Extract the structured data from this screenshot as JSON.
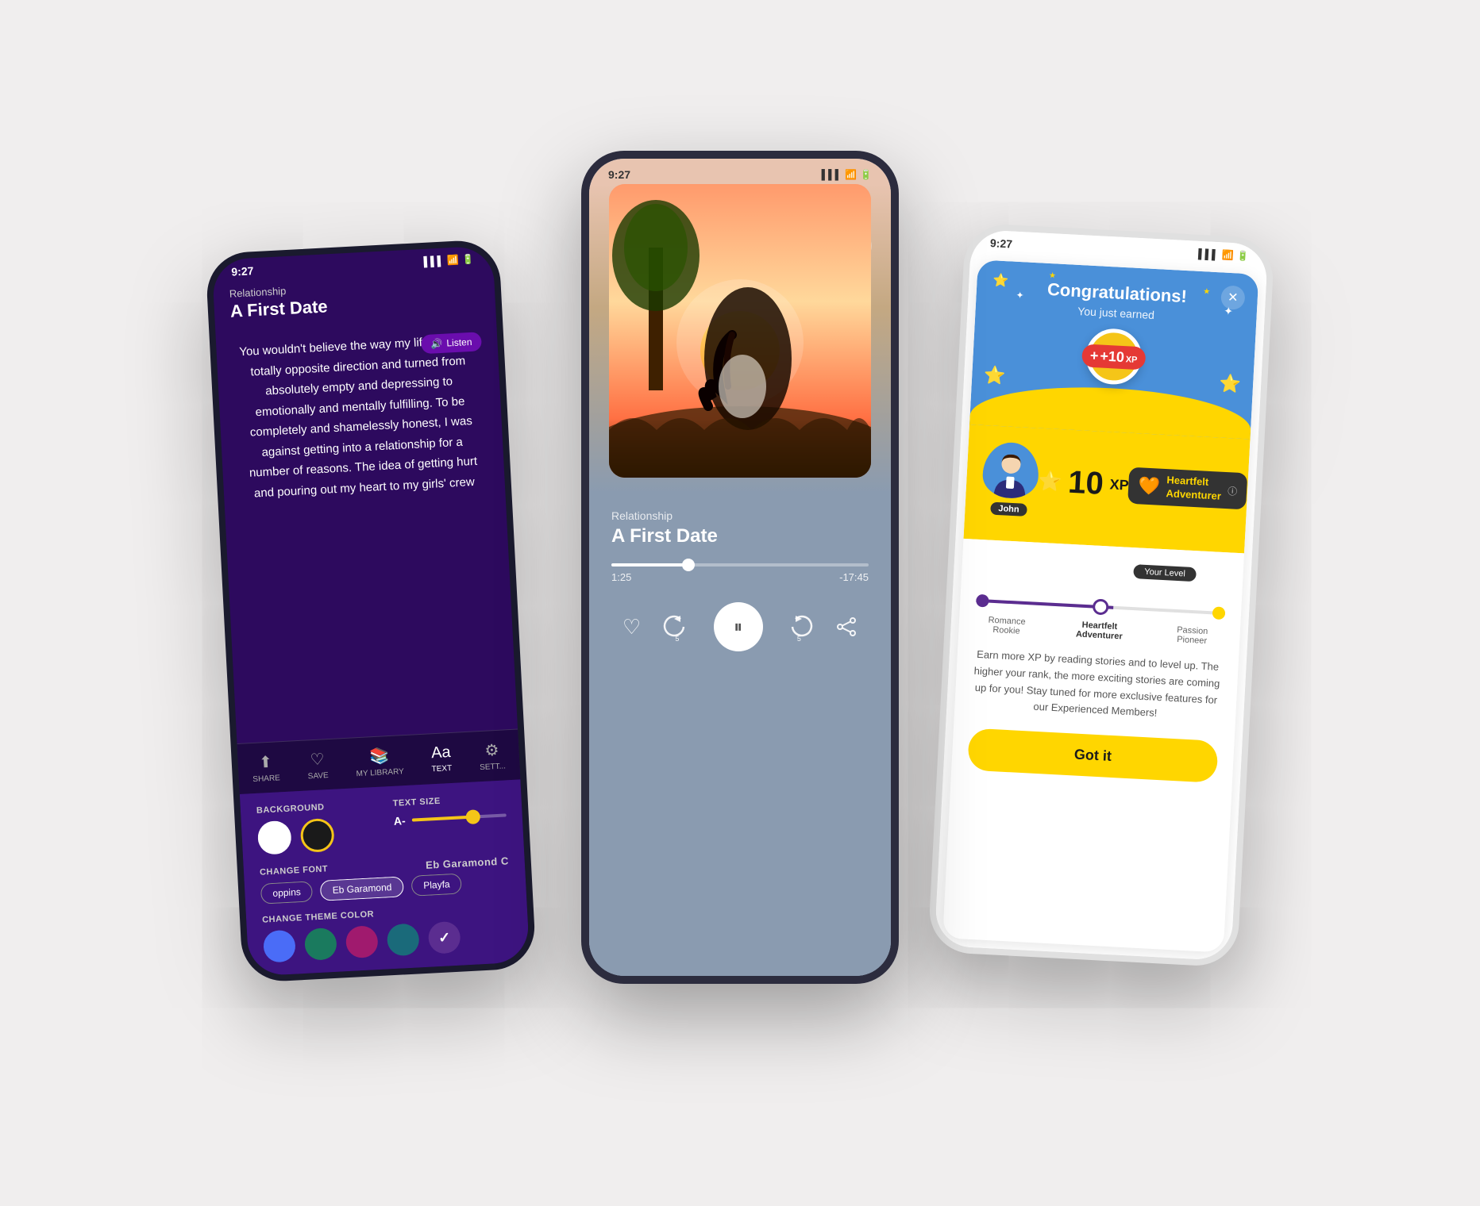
{
  "left_phone": {
    "status_bar": {
      "time": "9:27",
      "signal": "▌▌▌",
      "wifi": "WiFi",
      "battery": "Battery"
    },
    "header": {
      "category": "Relationship",
      "title": "A First Date",
      "listen_btn": "Listen"
    },
    "story_text": "You wouldn't believe the way my life took the totally opposite direction and turned from absolutely empty and depressing to emotionally and mentally fulfilling. To be completely and shamelessly honest, I was against getting into a relationship for a number of reasons. The idea of getting hurt and pouring out my heart to my girls' crew",
    "nav_items": [
      {
        "icon": "share",
        "label": "SHARE"
      },
      {
        "icon": "heart",
        "label": "SAVE"
      },
      {
        "icon": "library",
        "label": "MY LIBRARY"
      },
      {
        "icon": "text",
        "label": "TEXT"
      },
      {
        "icon": "settings",
        "label": "SETT..."
      }
    ],
    "settings": {
      "background_label": "BACKGROUND",
      "text_size_label": "TEXT SIZE",
      "text_size_value": "A-",
      "change_font_label": "CHANGE FONT",
      "current_font": "Eb Garamond C",
      "font_options": [
        "oppins",
        "Eb Garamond",
        "Playfa"
      ],
      "change_theme_label": "CHANGE THEME COLOR",
      "theme_colors": [
        {
          "color": "#4a6cf7",
          "selected": false
        },
        {
          "color": "#1a7a5e",
          "selected": false
        },
        {
          "color": "#a01a6e",
          "selected": false
        },
        {
          "color": "#1a6a7a",
          "selected": false
        },
        {
          "color": "#5b2d90",
          "selected": true
        }
      ]
    }
  },
  "center_phone": {
    "status_bar": {
      "time": "9:27",
      "signal": "signal",
      "wifi": "wifi",
      "battery": "battery"
    },
    "category": "Relationship",
    "title": "A First Date",
    "time_current": "1:25",
    "time_remaining": "-17:45",
    "controls": {
      "heart": "♡",
      "rewind": "↺5",
      "pause": "⏸",
      "forward": "↻5",
      "share": "share"
    }
  },
  "right_phone": {
    "status_bar": {
      "time": "9:27",
      "signal": "signal",
      "wifi": "wifi",
      "battery": "battery"
    },
    "modal": {
      "title": "Congratulations!",
      "subtitle": "You just earned",
      "xp_badge": "+10",
      "xp_label": "XP",
      "user_name": "John",
      "xp_amount": "10",
      "xp_unit": "XP",
      "rank_name": "Heartfelt\nAdventurer",
      "level_label": "Your Level",
      "level_items": [
        "Romance\nRookie",
        "Heartfelt\nAdventurer",
        "Passion\nPioneer"
      ],
      "earn_text": "Earn more XP by reading stories and to level up. The higher your rank, the more exciting stories are coming up for you! Stay tuned for more exclusive features for our Experienced Members!",
      "got_it_btn": "Got it"
    }
  }
}
